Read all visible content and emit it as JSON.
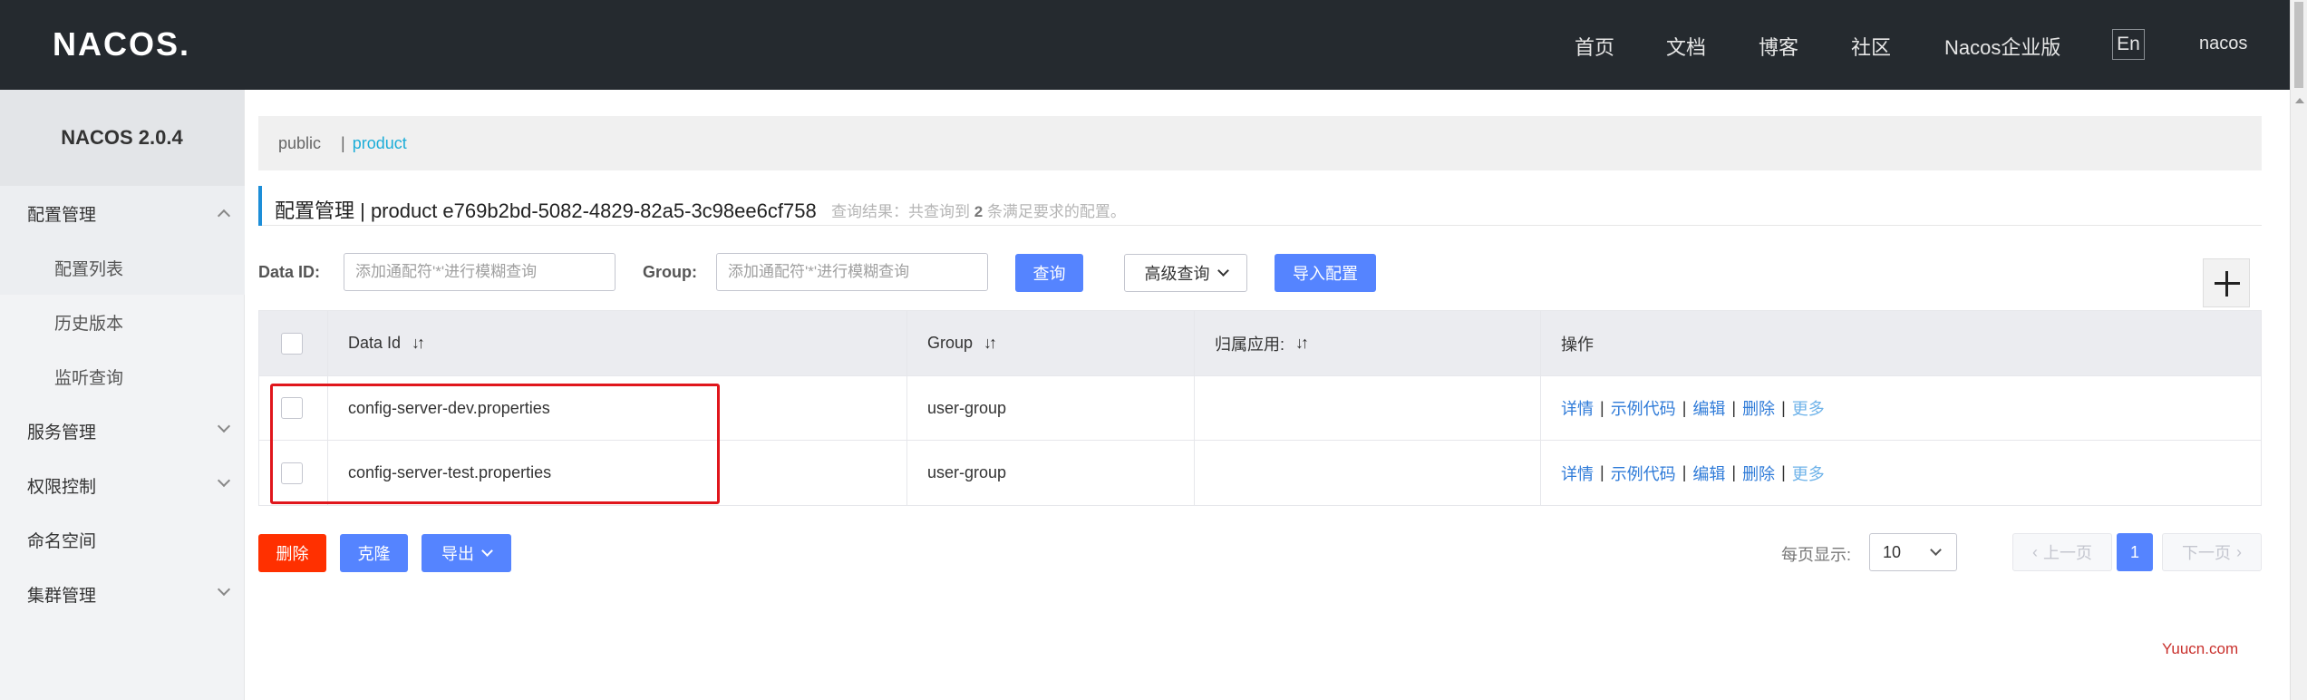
{
  "header": {
    "logo_text": "NACOS.",
    "nav": [
      "首页",
      "文档",
      "博客",
      "社区",
      "Nacos企业版"
    ],
    "lang": "En",
    "user": "nacos"
  },
  "sidebar": {
    "brand": "NACOS 2.0.4",
    "items": [
      {
        "label": "配置管理",
        "expanded": true
      },
      {
        "label": "配置列表"
      },
      {
        "label": "历史版本"
      },
      {
        "label": "监听查询"
      },
      {
        "label": "服务管理"
      },
      {
        "label": "权限控制"
      },
      {
        "label": "命名空间"
      },
      {
        "label": "集群管理"
      }
    ]
  },
  "namespaces": {
    "items": [
      "public",
      "product"
    ],
    "separator": "|",
    "active": "product"
  },
  "title": {
    "text": "配置管理  |  product  e769b2bd-5082-4829-82a5-3c98ee6cf758",
    "hint_prefix": "查询结果：共查询到",
    "hint_count": "2",
    "hint_suffix": "条满足要求的配置。"
  },
  "filters": {
    "data_id_label": "Data ID:",
    "data_id_placeholder": "添加通配符'*'进行模糊查询",
    "group_label": "Group:",
    "group_placeholder": "添加通配符'*'进行模糊查询",
    "query_button": "查询",
    "advanced_button": "高级查询",
    "import_button": "导入配置"
  },
  "table": {
    "columns": [
      "Data Id",
      "Group",
      "归属应用:",
      "操作"
    ],
    "rows": [
      {
        "data_id": "config-server-dev.properties",
        "group": "user-group",
        "app": ""
      },
      {
        "data_id": "config-server-test.properties",
        "group": "user-group",
        "app": ""
      }
    ],
    "actions": [
      "详情",
      "示例代码",
      "编辑",
      "删除",
      "更多"
    ],
    "action_separator": "|"
  },
  "bulk": {
    "delete": "删除",
    "clone": "克隆",
    "export": "导出"
  },
  "pagination": {
    "page_size_label": "每页显示:",
    "page_size": "10",
    "prev": "上一页",
    "next": "下一页",
    "current": "1"
  },
  "watermark": "Yuucn.com",
  "colors": {
    "header_bg": "#252a2f",
    "primary": "#5584ff",
    "danger": "#ff3000",
    "link": "#2f7bd8",
    "highlight_box": "#e0161c"
  }
}
